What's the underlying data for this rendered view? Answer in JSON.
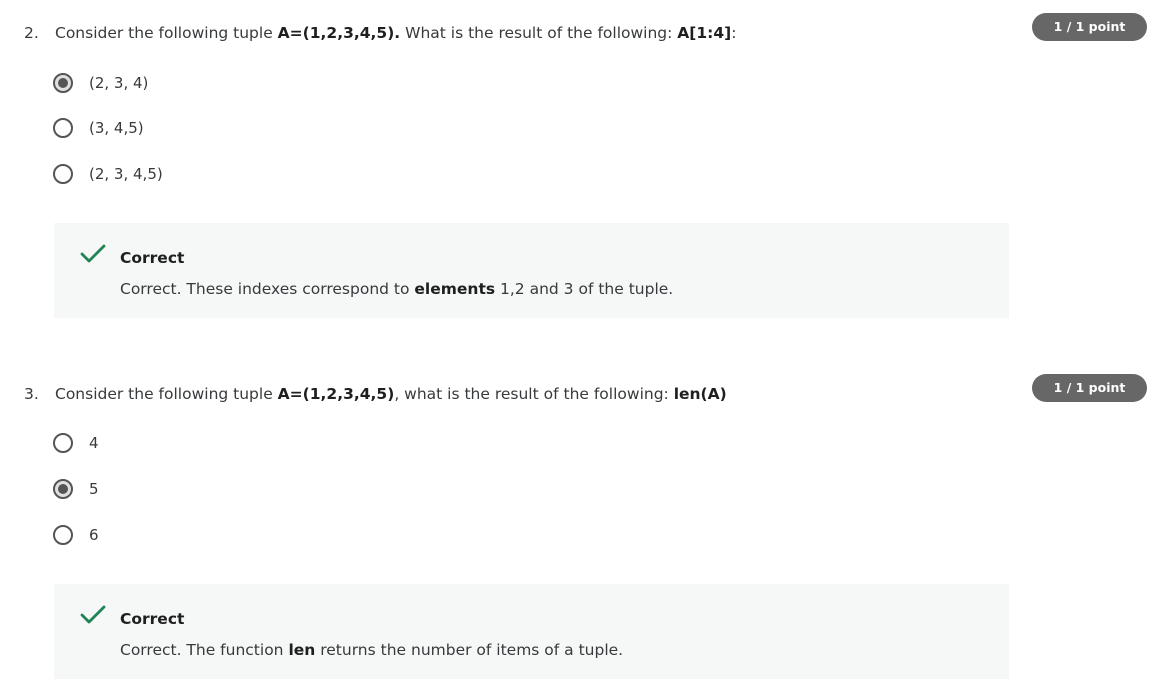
{
  "questions": [
    {
      "number": "2.",
      "text_parts": [
        "Consider the following tuple ",
        "A=(1,2,3,4,5).",
        " What is the result of the following: ",
        "A[1:4]",
        ":"
      ],
      "points": "1 / 1 point",
      "options": [
        {
          "label": "(2, 3, 4)",
          "selected": true
        },
        {
          "label": "(3, 4,5)",
          "selected": false
        },
        {
          "label": "(2, 3, 4,5)",
          "selected": false
        }
      ],
      "feedback": {
        "title": "Correct",
        "text_parts": [
          "Correct. These indexes correspond to ",
          "elements",
          " 1,2 and 3 of the tuple."
        ]
      }
    },
    {
      "number": "3.",
      "text_parts": [
        "Consider the following tuple ",
        "A=(1,2,3,4,5)",
        ", what is the result of the following: ",
        "len(A)",
        ""
      ],
      "points": "1 / 1 point",
      "options": [
        {
          "label": "4",
          "selected": false
        },
        {
          "label": "5",
          "selected": true
        },
        {
          "label": "6",
          "selected": false
        }
      ],
      "feedback": {
        "title": "Correct",
        "text_parts": [
          "Correct. The function ",
          "len",
          " returns the number of items of a tuple."
        ]
      }
    }
  ],
  "colors": {
    "check": "#1f8354",
    "badge": "#676767",
    "feedback_bg": "#f5f8f7"
  },
  "icons": {
    "check": "check-icon",
    "radio": "radio-button"
  }
}
